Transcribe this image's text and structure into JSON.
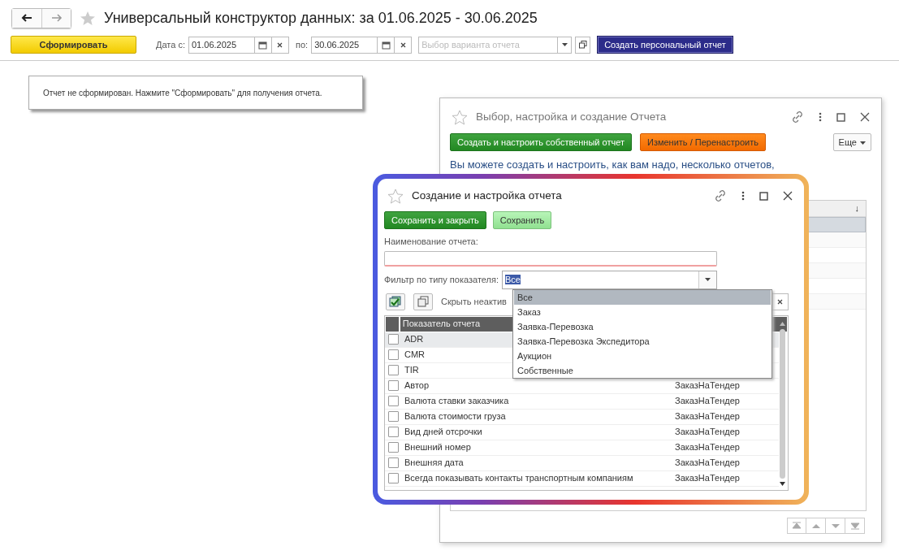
{
  "header": {
    "title": "Универсальный конструктор данных: за 01.06.2025 - 30.06.2025"
  },
  "toolbar": {
    "generate_button": "Сформировать",
    "date_from_label": "Дата с:",
    "date_from": "01.06.2025",
    "date_to_label": "по:",
    "date_to": "30.06.2025",
    "variant_placeholder": "Выбор варианта отчета",
    "personal_button": "Создать персональный отчет"
  },
  "report_message": "Отчет не сформирован. Нажмите \"Сформировать\" для получения отчета.",
  "selection_window": {
    "title": "Выбор, настройка и создание Отчета",
    "buttons": [
      {
        "label": "Создать и настроить собственный отчет",
        "kind": "create"
      },
      {
        "label": "Изменить / Перенастроить",
        "kind": "change"
      }
    ],
    "more_button": "Еще",
    "description": "Вы можете создать и настроить, как вам надо, несколько отчетов,",
    "table": {
      "sort_mark": "↓",
      "rows": [
        {
          "selected": true
        },
        {
          "selected": false
        },
        {
          "selected": false
        },
        {
          "selected": false
        },
        {
          "selected": false
        },
        {
          "selected": false
        }
      ]
    }
  },
  "edit_window": {
    "title": "Создание и настройка отчета",
    "buttons": [
      {
        "label": "Сохранить и закрыть",
        "kind": "primary"
      },
      {
        "label": "Сохранить",
        "kind": "secondary"
      }
    ],
    "name_label": "Наименование отчета:",
    "filter_label": "Фильтр по типу показателя:",
    "filter_value": "Все",
    "hide_inactive_label": "Скрыть неактив",
    "table": {
      "columns": [
        "Показатель отчета"
      ],
      "rows": [
        {
          "name": "ADR",
          "checked": false,
          "selected": true
        },
        {
          "name": "CMR",
          "checked": false,
          "selected": false
        },
        {
          "name": "TIR",
          "checked": false,
          "selected": false
        },
        {
          "name": "Автор",
          "type": "ЗаказНаТендер",
          "checked": false,
          "selected": false
        },
        {
          "name": "Валюта ставки заказчика",
          "type": "ЗаказНаТендер",
          "checked": false,
          "selected": false
        },
        {
          "name": "Валюта стоимости груза",
          "type": "ЗаказНаТендер",
          "checked": false,
          "selected": false
        },
        {
          "name": "Вид дней отсрочки",
          "type": "ЗаказНаТендер",
          "checked": false,
          "selected": false
        },
        {
          "name": "Внешний номер",
          "type": "ЗаказНаТендер",
          "checked": false,
          "selected": false
        },
        {
          "name": "Внешняя дата",
          "type": "ЗаказНаТендер",
          "checked": false,
          "selected": false
        },
        {
          "name": "Всегда показывать контакты транспортным компаниям",
          "type": "ЗаказНаТендер",
          "checked": false,
          "selected": false
        }
      ]
    },
    "dropdown": {
      "items": [
        {
          "label": "Все",
          "selected": true
        },
        {
          "label": "Заказ",
          "selected": false
        },
        {
          "label": "Заявка-Перевозка",
          "selected": false
        },
        {
          "label": "Заявка-Перевозка Экспедитора",
          "selected": false
        },
        {
          "label": "Аукцион",
          "selected": false
        },
        {
          "label": "Собственные",
          "selected": false
        }
      ]
    }
  }
}
